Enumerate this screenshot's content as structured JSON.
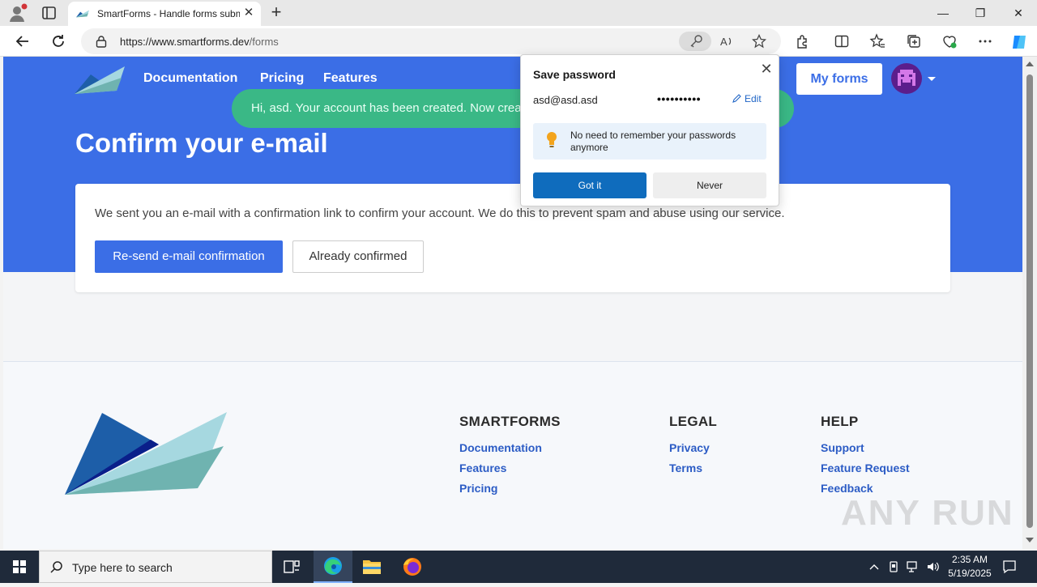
{
  "browser": {
    "tab_title": "SmartForms - Handle forms submissions",
    "tab_close": "✕",
    "new_tab": "+",
    "url_host": "https://www.smartforms.dev",
    "url_path": "/forms",
    "window_controls": {
      "minimize": "—",
      "restore": "❐",
      "close": "✕"
    }
  },
  "site": {
    "nav": [
      "Documentation",
      "Pricing",
      "Features"
    ],
    "my_forms": "My forms",
    "toast": "Hi, asd. Your account has been created. Now create your first form.",
    "heading": "Confirm your e-mail",
    "card_message": "We sent you an e-mail with a confirmation link to confirm your account. We do this to prevent spam and abuse using our service.",
    "resend_button": "Re-send e-mail confirmation",
    "confirmed_button": "Already confirmed"
  },
  "footer": {
    "columns": [
      {
        "heading": "SMARTFORMS",
        "links": [
          "Documentation",
          "Features",
          "Pricing"
        ]
      },
      {
        "heading": "LEGAL",
        "links": [
          "Privacy",
          "Terms"
        ]
      },
      {
        "heading": "HELP",
        "links": [
          "Support",
          "Feature Request",
          "Feedback"
        ]
      }
    ],
    "watermark": "ANY RUN"
  },
  "save_password": {
    "title": "Save password",
    "close": "✕",
    "username": "asd@asd.asd",
    "password_mask": "••••••••••",
    "edit": "Edit",
    "info": "No need to remember your passwords anymore",
    "got_it": "Got it",
    "never": "Never"
  },
  "taskbar": {
    "search_placeholder": "Type here to search",
    "time": "2:35 AM",
    "date": "5/19/2025"
  },
  "colors": {
    "brand_blue": "#3b6ee6",
    "toast_green": "#3ab886",
    "edge_blue": "#0f6cbd"
  }
}
